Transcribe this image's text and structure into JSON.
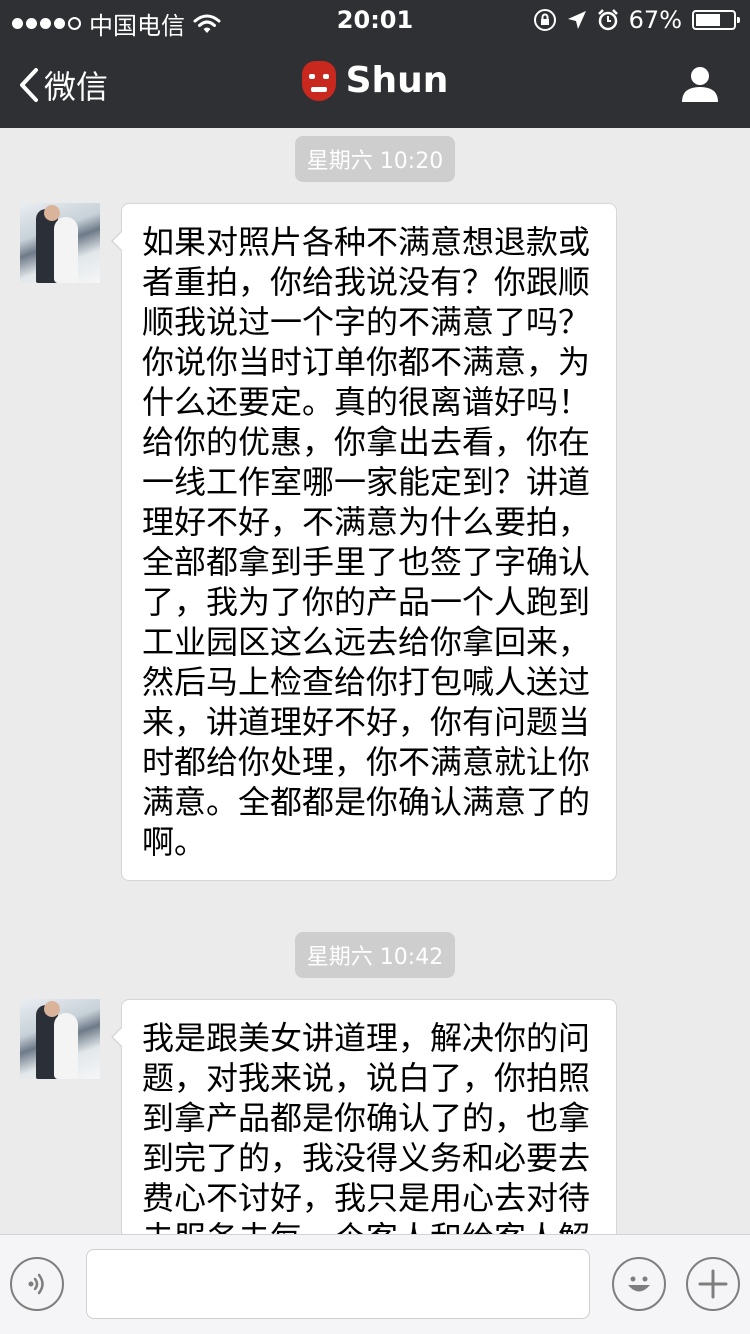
{
  "status_bar": {
    "carrier": "中国电信",
    "time": "20:01",
    "battery": "67%",
    "battery_level": 0.67,
    "signal_strength": "4 of 5"
  },
  "nav": {
    "back_label": "微信",
    "title": "Shun"
  },
  "messages": [
    {
      "timestamp": "星期六 10:20",
      "lines": [
        "如果对照片各种不满意想退款或",
        "者重拍，你给我说没有？你跟顺",
        "顺我说过一个字的不满意了吗？",
        "你说你当时订单你都不满意，为",
        "什么还要定。真的很离谱好吗！",
        "给你的优惠，你拿出去看，你在",
        "一线工作室哪一家能定到？讲道",
        "理好不好，不满意为什么要拍，",
        "全部都拿到手里了也签了字确认",
        "了，我为了你的产品一个人跑到",
        "工业园区这么远去给你拿回来，",
        "然后马上检查给你打包喊人送过",
        "来，讲道理好不好，你有问题当",
        "时都给你处理，你不满意就让你",
        "满意。全都都是你确认满意了的",
        "啊。"
      ]
    },
    {
      "timestamp": "星期六 10:42",
      "lines": [
        "我是跟美女讲道理，解决你的问",
        "题，对我来说，说白了，你拍照",
        "到拿产品都是你确认了的，也拿",
        "到完了的，我没得义务和必要去",
        "费心不讨好，我只是用心去对待",
        "去服务去每一个客人和给客人解"
      ]
    }
  ],
  "colors": {
    "topbar": "#2e3033",
    "background": "#ebebeb",
    "timestamp_bg": "#cecece"
  }
}
